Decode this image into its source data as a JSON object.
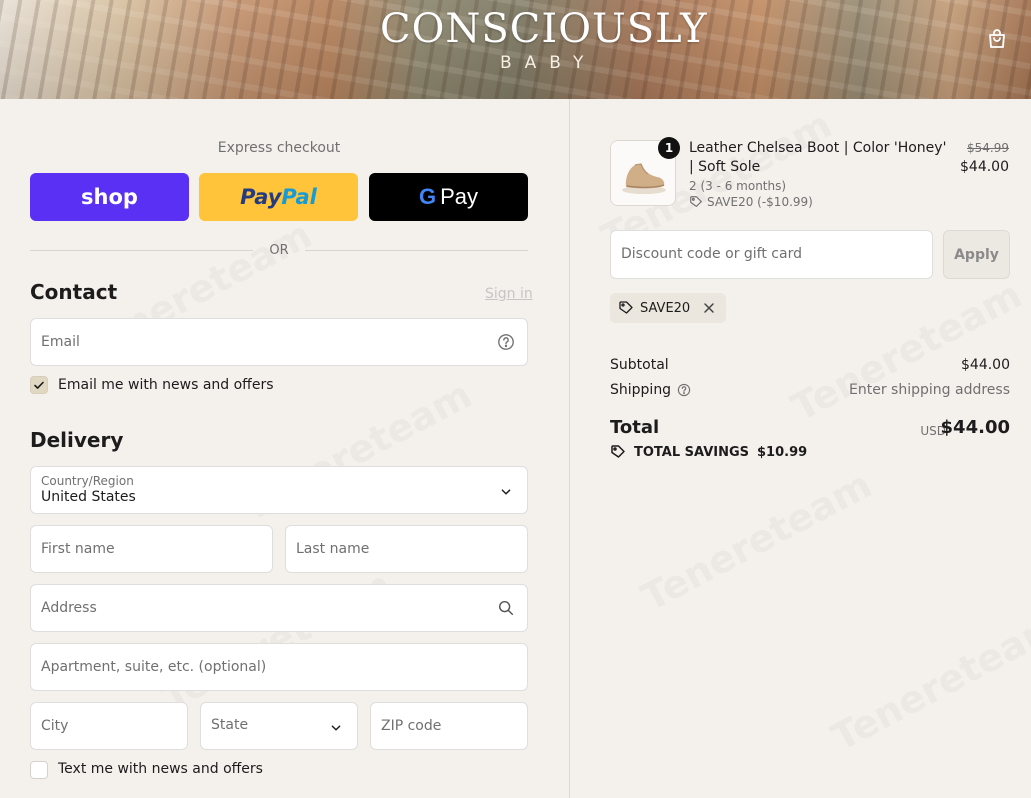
{
  "header": {
    "brand": "CONSCIOUSLY",
    "brand_sub": "BABY"
  },
  "express": {
    "title": "Express checkout",
    "shop_label": "shop",
    "paypal_label_1": "Pay",
    "paypal_label_2": "Pal",
    "gpay_g": "G",
    "gpay_label": "Pay",
    "or_label": "OR"
  },
  "contact": {
    "title": "Contact",
    "sign_in": "Sign in",
    "email_placeholder": "Email",
    "news_checkbox_label": "Email me with news and offers",
    "news_checked": true
  },
  "delivery": {
    "title": "Delivery",
    "country_label": "Country/Region",
    "country_value": "United States",
    "first_name_placeholder": "First name",
    "last_name_placeholder": "Last name",
    "address_placeholder": "Address",
    "apartment_placeholder": "Apartment, suite, etc. (optional)",
    "city_placeholder": "City",
    "state_placeholder": "State",
    "zip_placeholder": "ZIP code",
    "text_checkbox_label": "Text me with news and offers",
    "text_checked": false
  },
  "order": {
    "quantity": "1",
    "product_name": "Leather Chelsea Boot | Color 'Honey' | Soft Sole",
    "variant": "2 (3 - 6 months)",
    "discount_applied": "SAVE20 (-$10.99)",
    "price_original": "$54.99",
    "price_current": "$44.00",
    "discount_placeholder": "Discount code or gift card",
    "apply_label": "Apply",
    "code_chip": "SAVE20",
    "subtotal_label": "Subtotal",
    "subtotal_value": "$44.00",
    "shipping_label": "Shipping",
    "shipping_value": "Enter shipping address",
    "total_label": "Total",
    "total_currency": "USD",
    "total_value": "$44.00",
    "savings_label": "TOTAL SAVINGS",
    "savings_value": "$10.99"
  },
  "colors": {
    "shop_purple": "#5a31f4",
    "paypal_yellow": "#ffc439",
    "gpay_black": "#000000",
    "page_bg": "#f4f1ec"
  },
  "watermark": "Tenereteam"
}
